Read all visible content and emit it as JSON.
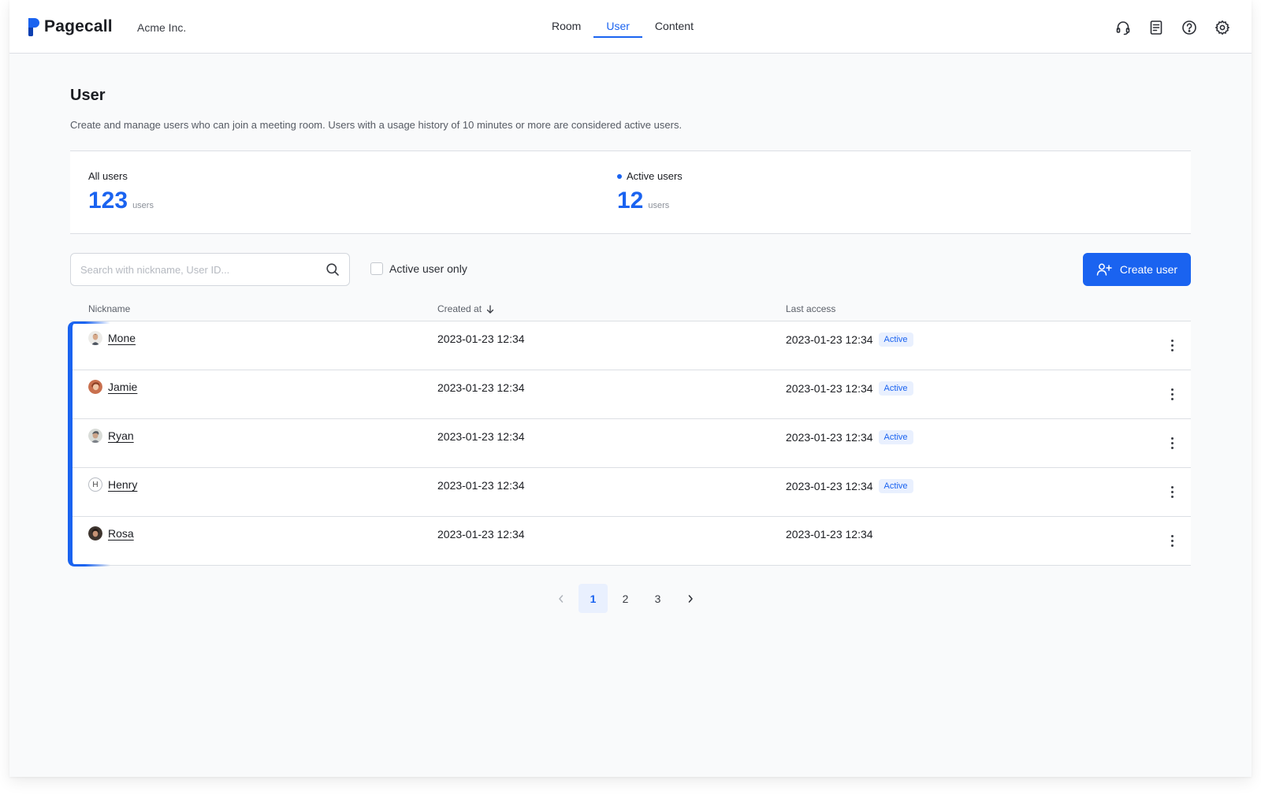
{
  "brand": {
    "name": "Pagecall",
    "org": "Acme Inc.",
    "accent": "#1a63f0"
  },
  "nav": {
    "tabs": [
      "Room",
      "User",
      "Content"
    ],
    "active": "User"
  },
  "header_icons": [
    "headset-icon",
    "document-icon",
    "help-icon",
    "gear-icon"
  ],
  "page": {
    "title": "User",
    "description": "Create and manage users who can join a meeting room. Users with a usage history of 10 minutes or more are considered active users."
  },
  "stats": {
    "all": {
      "label": "All users",
      "value": "123",
      "unit": "users"
    },
    "active": {
      "label": "Active users",
      "value": "12",
      "unit": "users"
    }
  },
  "toolbar": {
    "search_placeholder": "Search with nickname, User ID...",
    "search_value": "",
    "active_only_label": "Active user only",
    "active_only_checked": false,
    "create_label": "Create user"
  },
  "table": {
    "headers": {
      "nickname": "Nickname",
      "created": "Created at",
      "access": "Last access"
    },
    "sort": {
      "column": "created",
      "direction": "desc"
    },
    "rows": [
      {
        "nickname": "Mone",
        "avatar": "photo",
        "created": "2023-01-23 12:34",
        "access": "2023-01-23 12:34",
        "status": "Active"
      },
      {
        "nickname": "Jamie",
        "avatar": "photo",
        "created": "2023-01-23 12:34",
        "access": "2023-01-23 12:34",
        "status": "Active"
      },
      {
        "nickname": "Ryan",
        "avatar": "photo",
        "created": "2023-01-23 12:34",
        "access": "2023-01-23 12:34",
        "status": "Active"
      },
      {
        "nickname": "Henry",
        "avatar": "H",
        "created": "2023-01-23 12:34",
        "access": "2023-01-23 12:34",
        "status": "Active"
      },
      {
        "nickname": "Rosa",
        "avatar": "photo",
        "created": "2023-01-23 12:34",
        "access": "2023-01-23 12:34",
        "status": ""
      }
    ]
  },
  "pagination": {
    "pages": [
      "1",
      "2",
      "3"
    ],
    "current": "1"
  }
}
